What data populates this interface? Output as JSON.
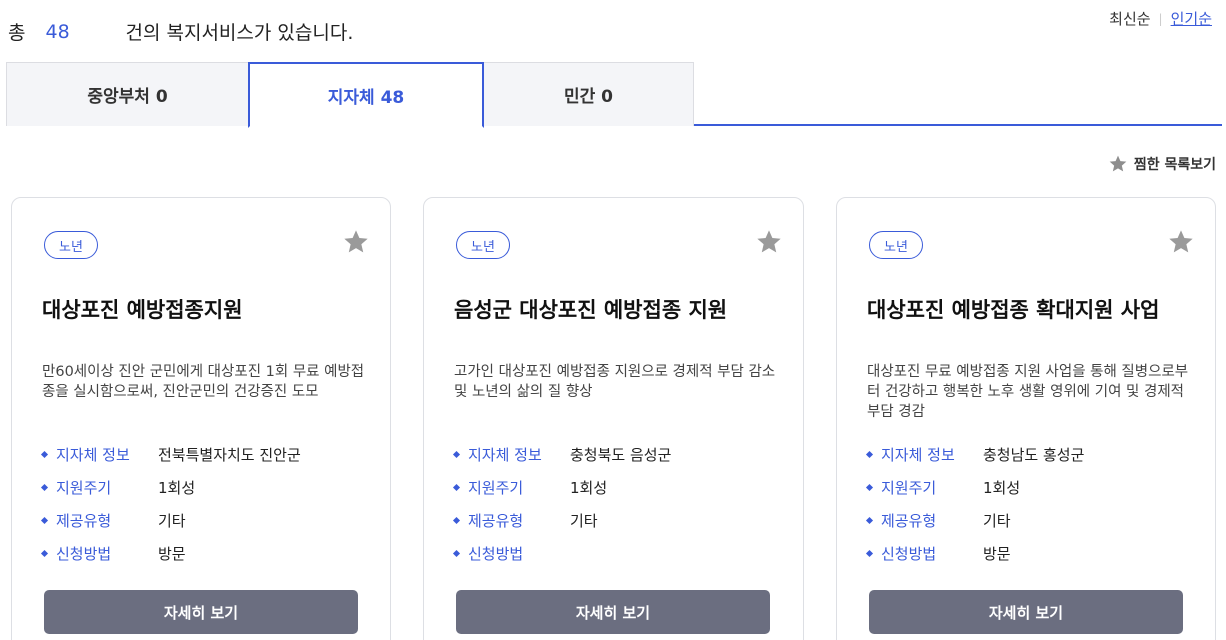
{
  "summary": {
    "prefix": "총",
    "count": "48",
    "suffix": "건의 복지서비스가 있습니다."
  },
  "sort": {
    "latest": "최신순",
    "popular": "인기순"
  },
  "tabs": [
    {
      "label": "중앙부처 0"
    },
    {
      "label": "지자체 48"
    },
    {
      "label": "민간 0"
    }
  ],
  "favorites_link": "찜한 목록보기",
  "colors": {
    "accent": "#3a5bd9",
    "button": "#6b6e80",
    "star": "#9a9a9a"
  },
  "cards": [
    {
      "badge": "노년",
      "title": "대상포진 예방접종지원",
      "description": "만60세이상 진안 군민에게 대상포진 1회 무료 예방접종을 실시함으로써, 진안군민의 건강증진 도모",
      "info": [
        {
          "label": "지자체 정보",
          "value": "전북특별자치도 진안군"
        },
        {
          "label": "지원주기",
          "value": "1회성"
        },
        {
          "label": "제공유형",
          "value": "기타"
        },
        {
          "label": "신청방법",
          "value": "방문"
        }
      ],
      "button": "자세히 보기"
    },
    {
      "badge": "노년",
      "title": "음성군 대상포진 예방접종 지원",
      "description": "고가인 대상포진 예방접종 지원으로 경제적 부담 감소 및 노년의 삶의 질 향상",
      "info": [
        {
          "label": "지자체 정보",
          "value": "충청북도 음성군"
        },
        {
          "label": "지원주기",
          "value": "1회성"
        },
        {
          "label": "제공유형",
          "value": "기타"
        },
        {
          "label": "신청방법",
          "value": ""
        }
      ],
      "button": "자세히 보기"
    },
    {
      "badge": "노년",
      "title": "대상포진 예방접종 확대지원 사업",
      "description": "대상포진 무료 예방접종 지원 사업을 통해 질병으로부터 건강하고 행복한 노후 생활 영위에 기여 및 경제적 부담 경감",
      "info": [
        {
          "label": "지자체 정보",
          "value": "충청남도 홍성군"
        },
        {
          "label": "지원주기",
          "value": "1회성"
        },
        {
          "label": "제공유형",
          "value": "기타"
        },
        {
          "label": "신청방법",
          "value": "방문"
        }
      ],
      "button": "자세히 보기"
    }
  ]
}
